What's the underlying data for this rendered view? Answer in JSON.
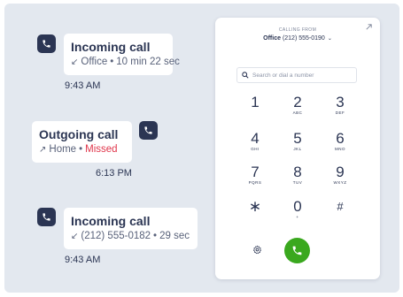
{
  "call_log": [
    {
      "title": "Incoming call",
      "direction_arrow": "↙",
      "location": "Office",
      "separator": "•",
      "detail": "10 min 22 sec",
      "time": "9:43 AM"
    },
    {
      "title": "Outgoing call",
      "direction_arrow": "↗",
      "location": "Home",
      "separator": "•",
      "detail": "Missed",
      "time": "6:13 PM"
    },
    {
      "title": "Incoming call",
      "direction_arrow": "↙",
      "location": "(212) 555-0182",
      "separator": "•",
      "detail": "29 sec",
      "time": "9:43 AM"
    }
  ],
  "dialer": {
    "calling_from_label": "CALLING FROM",
    "caller_name": "Office",
    "caller_number": "(212) 555-0190",
    "caller_chevron": "⌄",
    "search_placeholder": "Search or dial a number",
    "keys": [
      {
        "digit": "1",
        "letters": ""
      },
      {
        "digit": "2",
        "letters": "ABC"
      },
      {
        "digit": "3",
        "letters": "DEF"
      },
      {
        "digit": "4",
        "letters": "GHI"
      },
      {
        "digit": "5",
        "letters": "JKL"
      },
      {
        "digit": "6",
        "letters": "MNO"
      },
      {
        "digit": "7",
        "letters": "PQRS"
      },
      {
        "digit": "8",
        "letters": "TUV"
      },
      {
        "digit": "9",
        "letters": "WXYZ"
      },
      {
        "digit": "∗",
        "letters": ""
      },
      {
        "digit": "0",
        "letters": "+"
      },
      {
        "digit": "#",
        "letters": ""
      }
    ]
  },
  "colors": {
    "background": "#e3e8ef",
    "navy": "#2b3553",
    "missed": "#e0364b",
    "call_green": "#3aa81e"
  },
  "icons": {
    "log_badge": "phone-icon",
    "expand": "expand-arrow-icon",
    "search": "search-icon",
    "settings": "gear-icon",
    "call": "phone-icon"
  }
}
